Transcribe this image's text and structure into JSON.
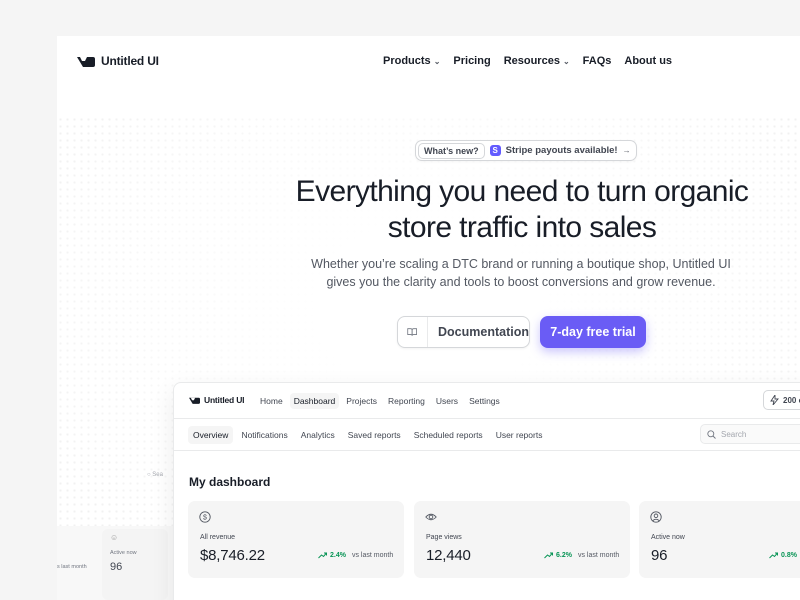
{
  "brand": {
    "name": "Untitled UI"
  },
  "nav": {
    "items": [
      {
        "label": "Products",
        "dropdown": true
      },
      {
        "label": "Pricing",
        "dropdown": false
      },
      {
        "label": "Resources",
        "dropdown": true
      },
      {
        "label": "FAQs",
        "dropdown": false
      },
      {
        "label": "About us",
        "dropdown": false
      }
    ]
  },
  "announcement": {
    "badge": "What’s new?",
    "icon_letter": "S",
    "text": "Stripe payouts available!",
    "arrow": "→"
  },
  "hero": {
    "title": "Everything you need to turn organic store traffic into sales",
    "subtitle": "Whether you’re scaling a DTC brand or running a boutique shop, Untitled UI gives you the clarity and tools to boost conversions and grow revenue.",
    "doc_button": "Documentation",
    "trial_button": "7-day free trial"
  },
  "dashboard": {
    "brand": "Untitled UI",
    "nav": [
      "Home",
      "Dashboard",
      "Projects",
      "Reporting",
      "Users",
      "Settings"
    ],
    "active_nav": "Dashboard",
    "credits": "200 c",
    "tabs": [
      "Overview",
      "Notifications",
      "Analytics",
      "Saved reports",
      "Scheduled reports",
      "User reports"
    ],
    "active_tab": "Overview",
    "search_placeholder": "Search",
    "title": "My dashboard",
    "cards": [
      {
        "icon": "dollar-icon",
        "label": "All revenue",
        "value": "$8,746.22",
        "change": "2.4%",
        "compare": "vs last month"
      },
      {
        "icon": "eye-icon",
        "label": "Page views",
        "value": "12,440",
        "change": "6.2%",
        "compare": "vs last month"
      },
      {
        "icon": "user-icon",
        "label": "Active now",
        "value": "96",
        "change": "0.8%",
        "compare": ""
      }
    ]
  },
  "background_card": {
    "search": "Sea",
    "label": "Active now",
    "value": "96",
    "compare": "s last month"
  },
  "colors": {
    "accent": "#6a5cf5",
    "positive": "#079455",
    "stripe": "#635bff"
  }
}
